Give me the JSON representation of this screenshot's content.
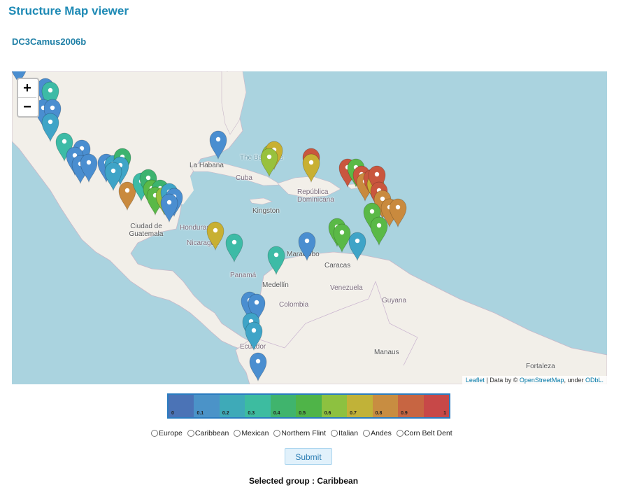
{
  "app_title": "Structure Map viewer",
  "dataset_name": "DC3Camus2006b",
  "map": {
    "zoom_in_label": "+",
    "zoom_out_label": "−",
    "attribution": {
      "leaflet": "Leaflet",
      "data_by": " | Data by © ",
      "osm": "OpenStreetMap",
      "under": ", under ",
      "odbl": "ODbL."
    },
    "place_labels": [
      "The Bahamas",
      "La Habana",
      "Cuba",
      "República Dominicana",
      "Kingston",
      "Honduras",
      "Ciudad de Guatemala",
      "Nicaragua",
      "Panamá",
      "Medellín",
      "Maracaibo",
      "Caracas",
      "Venezuela",
      "Colombia",
      "Guyana",
      "Ecuador",
      "Manaus",
      "Fortaleza"
    ],
    "marker_colors": {
      "0.0": "#4a70b5",
      "0.1": "#4a8ed0",
      "0.2": "#3fa4c7",
      "0.3": "#3dbba6",
      "0.4": "#3db36f",
      "0.5": "#5ab947",
      "0.6": "#98c13d",
      "0.7": "#c8b032",
      "0.8": "#c98a3e",
      "0.9": "#c9563e",
      "1.0": "#c63d3d"
    }
  },
  "legend": {
    "ticks": [
      "0",
      "0.1",
      "0.2",
      "0.3",
      "0.4",
      "0.5",
      "0.6",
      "0.7",
      "0.8",
      "0.9",
      "1"
    ],
    "colors": [
      "#4b73b6",
      "#4b93c8",
      "#3eaab8",
      "#3dbca0",
      "#40b46d",
      "#4fb448",
      "#8dc140",
      "#c1b238",
      "#c88d41",
      "#c76542",
      "#c74848"
    ]
  },
  "groups": {
    "options": [
      "Europe",
      "Caribbean",
      "Mexican",
      "Northern Flint",
      "Italian",
      "Andes",
      "Corn Belt Dent"
    ],
    "selected": "Caribbean"
  },
  "submit_label": "Submit",
  "selected_group_text": "Selected group : Caribbean"
}
